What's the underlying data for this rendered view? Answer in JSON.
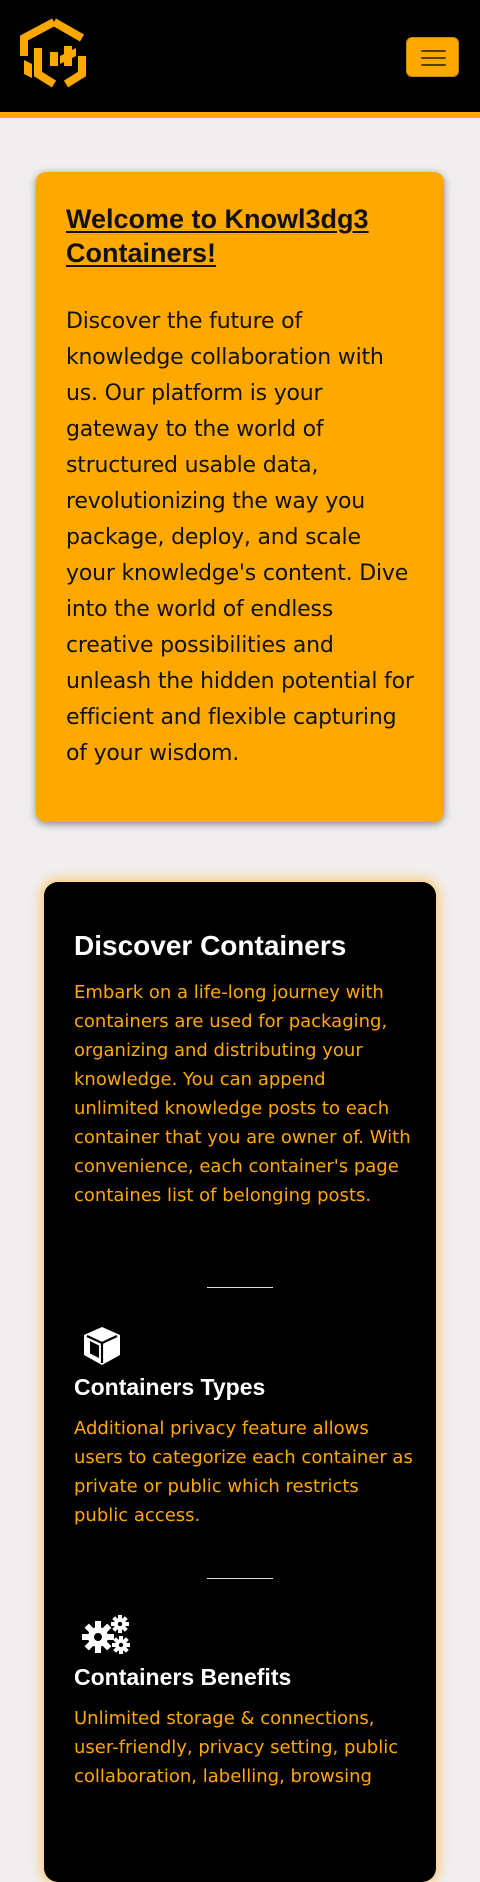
{
  "header": {
    "logo": "k3c-cube-logo",
    "menu_icon": "hamburger-icon",
    "accent_color": "#ffa800"
  },
  "welcome": {
    "title": "Welcome to Knowl3dg3 Containers!",
    "text": "Discover the future of knowledge collaboration with us. Our platform is your gateway to the world of structured usable data, revolutionizing the way you package, deploy, and scale your knowledge's content. Dive into the world of endless creative possibilities and unleash the hidden potential for efficient and flexible capturing of your wisdom."
  },
  "discover": {
    "title": "Discover Containers",
    "text": "Embark on a life-long journey with containers are used for packaging, organizing and distributing your knowledge. You can append unlimited knowledge posts to each container that you are owner of. With convenience, each container's page containes list of belonging posts."
  },
  "features": [
    {
      "icon": "box-icon",
      "title": "Containers Types",
      "text": "Additional privacy feature allows users to categorize each container as private or public which restricts public access."
    },
    {
      "icon": "gears-icon",
      "title": "Containers Benefits",
      "text": "Unlimited storage & connections, user-friendly, privacy setting, public collaboration, labelling, browsing"
    }
  ]
}
